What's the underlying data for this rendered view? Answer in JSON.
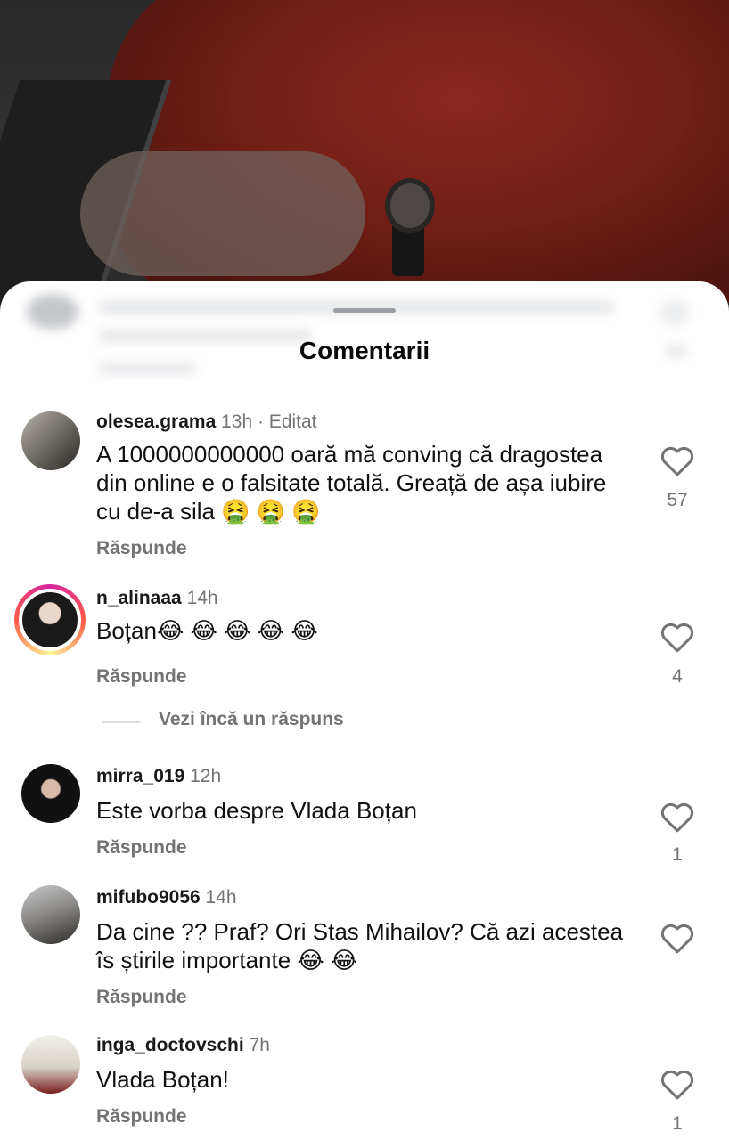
{
  "sheet": {
    "title": "Comentarii"
  },
  "reply_label": "Răspunde",
  "comments": [
    {
      "username": "olesea.grama",
      "time": "13h",
      "edited": "· Editat",
      "text": "A 1000000000000 oară mă conving că dragostea din online e o falsitate totală. Greață de așa iubire cu de-a sila 🤮 🤮 🤮",
      "likes": "57"
    },
    {
      "username": "n_alinaaa",
      "time": "14h",
      "edited": "",
      "text": "Boțan😂 😂 😂 😂 😂",
      "likes": "4",
      "more_replies": "Vezi încă un răspuns"
    },
    {
      "username": "mirra_019",
      "time": "12h",
      "edited": "",
      "text": "Este vorba despre Vlada Boțan",
      "likes": "1"
    },
    {
      "username": "mifubo9056",
      "time": "14h",
      "edited": "",
      "text": "Da cine ?? Praf? Ori Stas Mihailov? Că azi acestea îs știrile importante 😂 😂",
      "likes": ""
    },
    {
      "username": "inga_doctovschi",
      "time": "7h",
      "edited": "",
      "text": "Vlada Boțan!",
      "likes": "1"
    }
  ],
  "icons": {
    "like": "heart-outline-icon"
  },
  "colors": {
    "sheet_bg": "#ffffff",
    "secondary_text": "#737373",
    "primary_text": "#111111"
  }
}
